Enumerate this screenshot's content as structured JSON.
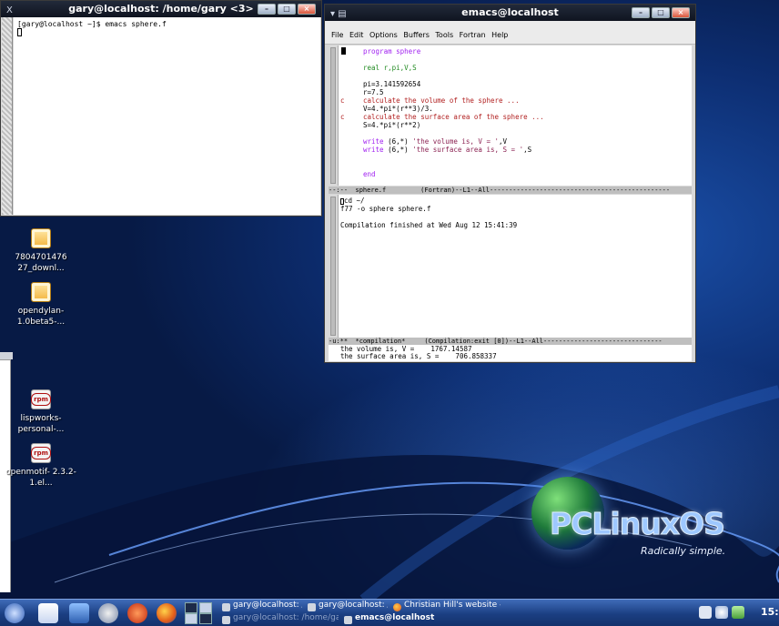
{
  "xterm": {
    "title": "gary@localhost: /home/gary <3>",
    "menu_glyph": "X",
    "prompt_line": "[gary@localhost ~]$ emacs sphere.f"
  },
  "emacs": {
    "title": "emacs@localhost",
    "menu": [
      "File",
      "Edit",
      "Options",
      "Buffers",
      "Tools",
      "Fortran",
      "Help"
    ],
    "code": [
      {
        "gutter": "",
        "text": "program sphere",
        "cls": "kw"
      },
      {
        "gutter": "",
        "text": "real r,pi,V,S",
        "cls": "ty"
      },
      {
        "gutter": "",
        "text": "pi=3.141592654",
        "cls": ""
      },
      {
        "gutter": "",
        "text": "r=7.5",
        "cls": ""
      },
      {
        "gutter": "c",
        "text": "calculate the volume of the sphere ...",
        "cls": "cm"
      },
      {
        "gutter": "",
        "text": "V=4.*pi*(r**3)/3.",
        "cls": ""
      },
      {
        "gutter": "c",
        "text": "calculate the surface area of the sphere ...",
        "cls": "cm"
      },
      {
        "gutter": "",
        "text": "S=4.*pi*(r**2)",
        "cls": ""
      },
      {
        "gutter": "",
        "text": "write (6,*) 'the volume is, V = ',V",
        "cls": "w"
      },
      {
        "gutter": "",
        "text": "write (6,*) 'the surface area is, S = ',S",
        "cls": "w"
      },
      {
        "gutter": "",
        "text": "end",
        "cls": "kw"
      }
    ],
    "write_kw": "write",
    "modeline_top": "--:--  sphere.f         (Fortran)--L1--All-----------------------------------------------",
    "compilation": [
      "cd ~/",
      "f77 -o sphere sphere.f",
      "Compilation finished at Wed Aug 12 15:41:39"
    ],
    "modeline_bottom": "-u:**  *compilation*     (Compilation:exit [0])--L1--All-------------------------------",
    "echo": [
      "the volume is, V =    1767.14587",
      "the surface area is, S =    706.858337"
    ]
  },
  "desktop_icons": [
    {
      "label": "7804701476 27_downl...",
      "kind": "pkg"
    },
    {
      "label": "opendylan- 1.0beta5-...",
      "kind": "pkg"
    },
    {
      "label": "lispworks- personal-...",
      "kind": "rpm"
    },
    {
      "label": "openmotif- 2.3.2-1.el...",
      "kind": "rpm"
    }
  ],
  "rpm_badge": "rpm",
  "branding": {
    "name": "PCLinuxOS",
    "slogan": "Radically simple."
  },
  "taskbar": {
    "tasks_top": [
      "gary@localhost: /home/ga",
      "gary@localhost: /home/ga",
      "Christian Hill's website -"
    ],
    "tasks_bottom": [
      "gary@localhost: /home/ga",
      "emacs@localhost"
    ],
    "clock": "15:"
  }
}
